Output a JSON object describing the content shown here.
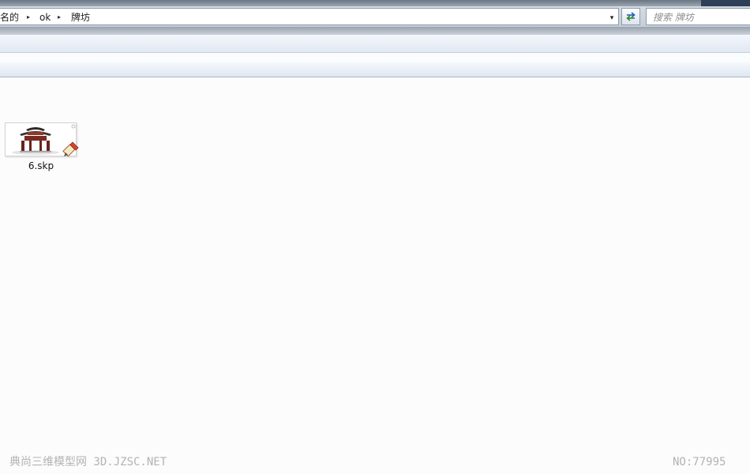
{
  "breadcrumb": {
    "items": [
      "名的",
      "ok",
      "牌坊"
    ],
    "separator": "▸",
    "dropdown": "▾"
  },
  "search": {
    "placeholder": "搜索 牌坊"
  },
  "files": [
    {
      "name": "6.skp",
      "icon": "sketchup-file-icon"
    }
  ],
  "watermark": {
    "left": "典尚三维模型网 3D.JZSC.NET",
    "right": "NO:77995"
  },
  "colors": {
    "content_bg": "#fcfcfc",
    "toolbar": "#e2e8f3",
    "watermark": "#b3b3b3"
  }
}
